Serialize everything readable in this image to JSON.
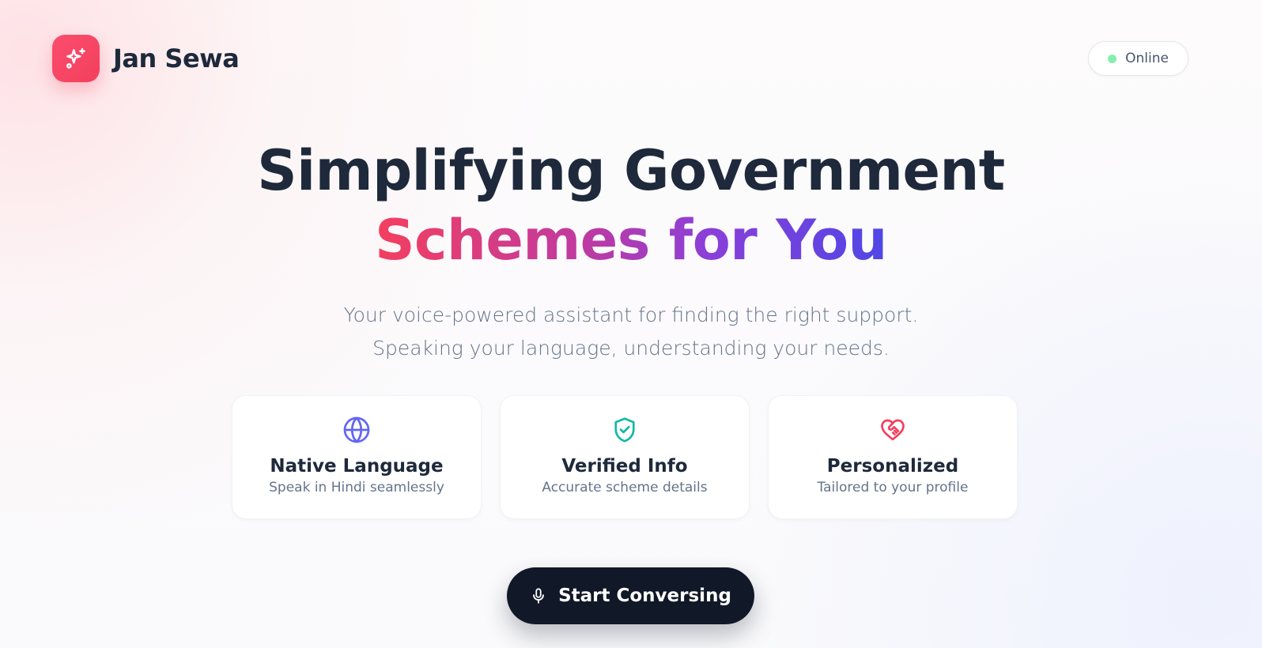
{
  "brand": {
    "name": "Jan Sewa",
    "logo_icon": "sparkles-icon",
    "accent_color": "#f43f5e"
  },
  "status": {
    "label": "Online",
    "dot_color": "#86efac"
  },
  "hero": {
    "headline_line1": "Simplifying Government",
    "headline_line2": "Schemes for You",
    "subtitle_line1": "Your voice-powered assistant for finding the right support.",
    "subtitle_line2": "Speaking your language, understanding your needs."
  },
  "features": [
    {
      "icon": "globe-icon",
      "title": "Native Language",
      "description": "Speak in Hindi seamlessly",
      "icon_color": "#6366f1"
    },
    {
      "icon": "shield-check-icon",
      "title": "Verified Info",
      "description": "Accurate scheme details",
      "icon_color": "#14b8a6"
    },
    {
      "icon": "heart-handshake-icon",
      "title": "Personalized",
      "description": "Tailored to your profile",
      "icon_color": "#f43f5e"
    }
  ],
  "cta": {
    "label": "Start Conversing",
    "icon": "microphone-icon"
  }
}
